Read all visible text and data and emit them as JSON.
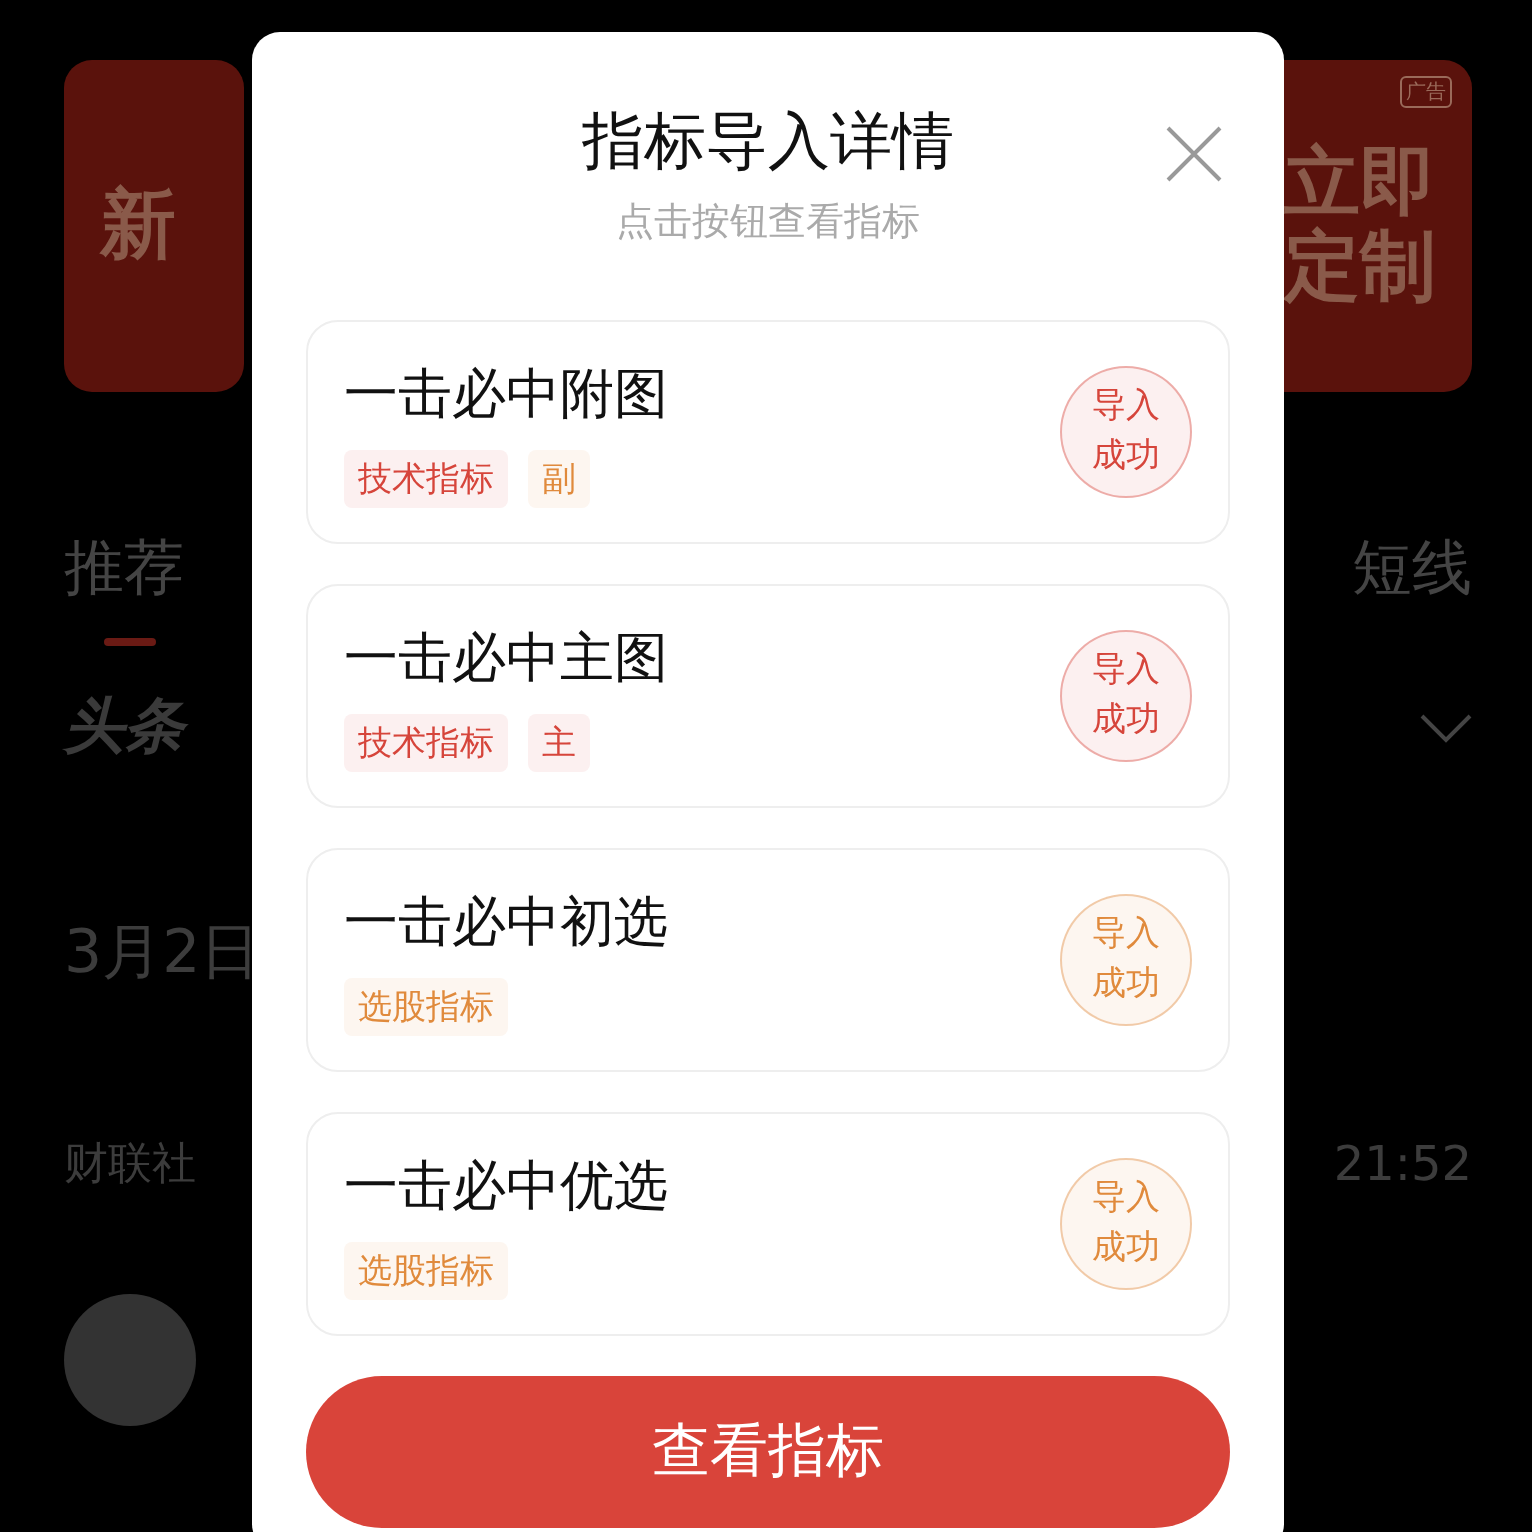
{
  "background": {
    "banner_left": "新",
    "banner_right": [
      "立即",
      "定制"
    ],
    "ad_badge": "广告",
    "tabs": [
      {
        "label": "推荐",
        "selected": true
      },
      {
        "label": "短线",
        "selected": false
      }
    ],
    "headline_logo": "头条",
    "date": "3月2日",
    "source": "财联社",
    "time": "21:52"
  },
  "dialog": {
    "title": "指标导入详情",
    "subtitle": "点击按钮查看指标",
    "items": [
      {
        "name": "一击必中附图",
        "tags": [
          {
            "label": "技术指标",
            "color": "#d6453b"
          },
          {
            "label": "副",
            "color": "#e08a3c"
          }
        ],
        "status": {
          "lines": [
            "导入",
            "成功"
          ],
          "color": "#d6453b"
        }
      },
      {
        "name": "一击必中主图",
        "tags": [
          {
            "label": "技术指标",
            "color": "#d6453b"
          },
          {
            "label": "主",
            "color": "#d6453b"
          }
        ],
        "status": {
          "lines": [
            "导入",
            "成功"
          ],
          "color": "#d6453b"
        }
      },
      {
        "name": "一击必中初选",
        "tags": [
          {
            "label": "选股指标",
            "color": "#e08a3c"
          }
        ],
        "status": {
          "lines": [
            "导入",
            "成功"
          ],
          "color": "#e08a3c"
        }
      },
      {
        "name": "一击必中优选",
        "tags": [
          {
            "label": "选股指标",
            "color": "#e08a3c"
          }
        ],
        "status": {
          "lines": [
            "导入",
            "成功"
          ],
          "color": "#e08a3c"
        }
      }
    ],
    "button": "查看指标"
  }
}
